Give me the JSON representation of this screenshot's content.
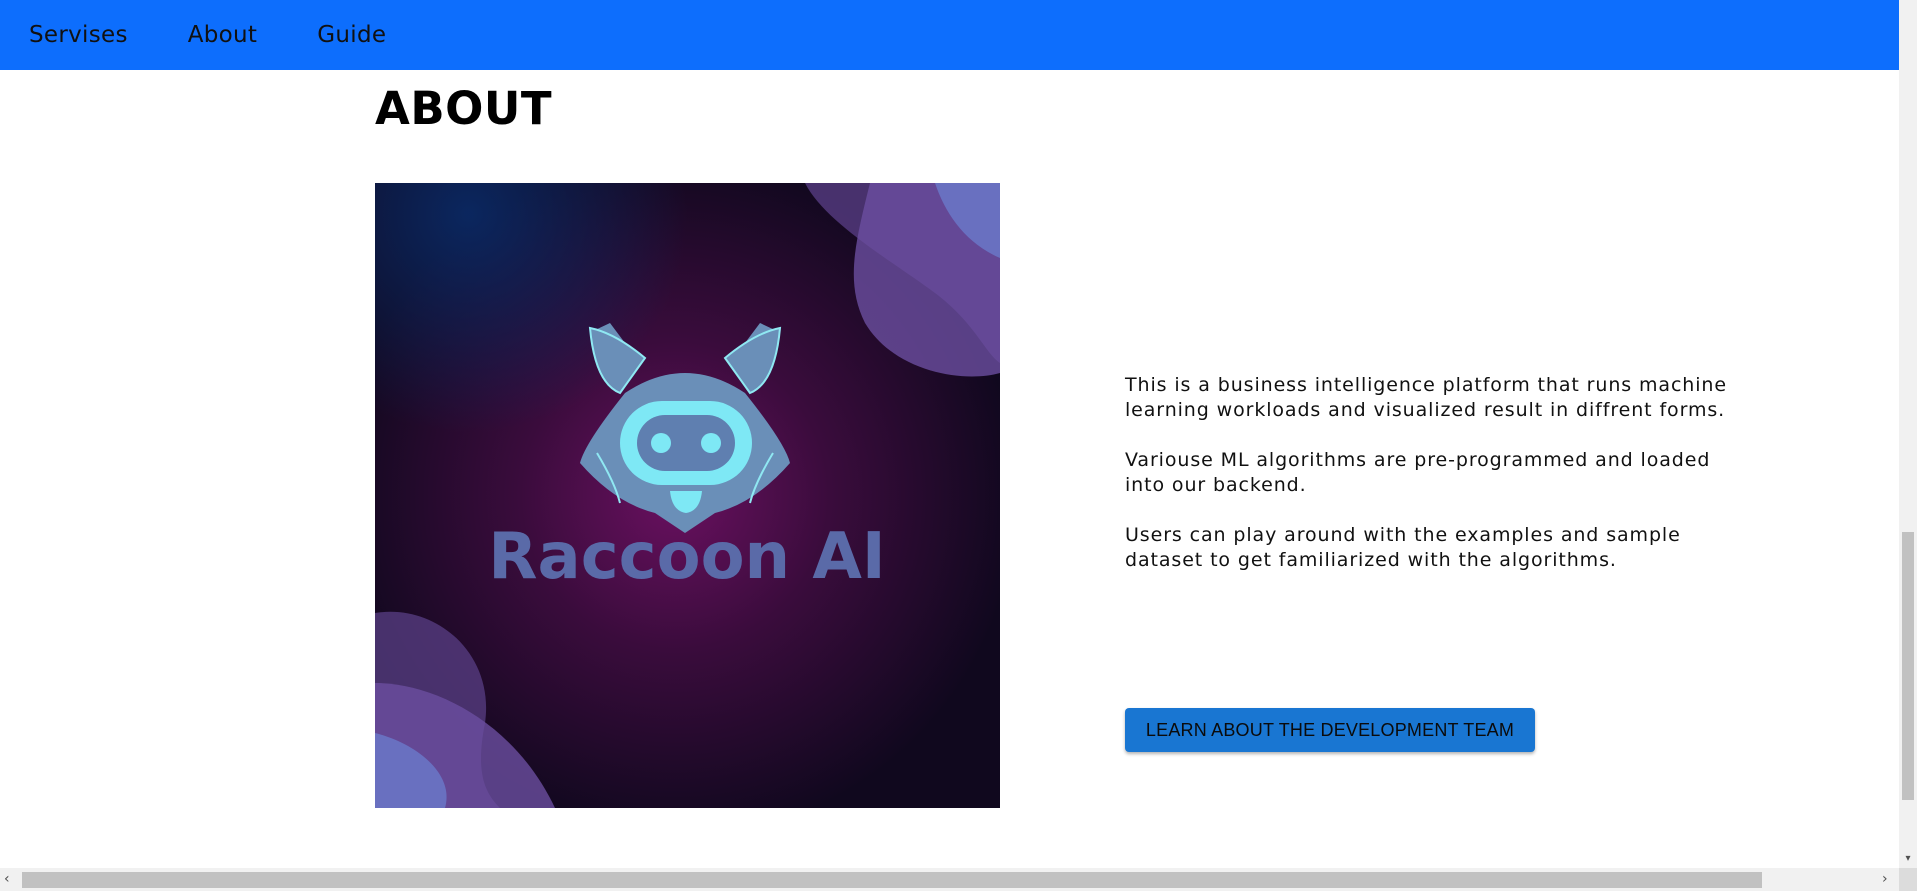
{
  "nav": {
    "items": [
      {
        "label": "Servises"
      },
      {
        "label": "About"
      },
      {
        "label": "Guide"
      }
    ]
  },
  "main": {
    "title": "ABOUT",
    "logo": {
      "text": "Raccoon AI",
      "alt": "Raccoon AI logo",
      "colors": {
        "background": "#12081f",
        "glow": "#5a0f56",
        "icon": "#7ee8f5",
        "text": "#5a6aa8"
      }
    },
    "paragraphs": [
      "This is a business intelligence platform that runs machine learning workloads and visualized result in diffrent forms.",
      "Variouse ML algorithms are pre-programmed and loaded into our backend.",
      "Users can play around with the examples and sample dataset to get familiarized with the algorithms."
    ],
    "team_button_label": "LEARN ABOUT THE DEVELOPMENT TEAM"
  },
  "colors": {
    "navbar": "#0d6efd",
    "button": "#1976d2"
  }
}
